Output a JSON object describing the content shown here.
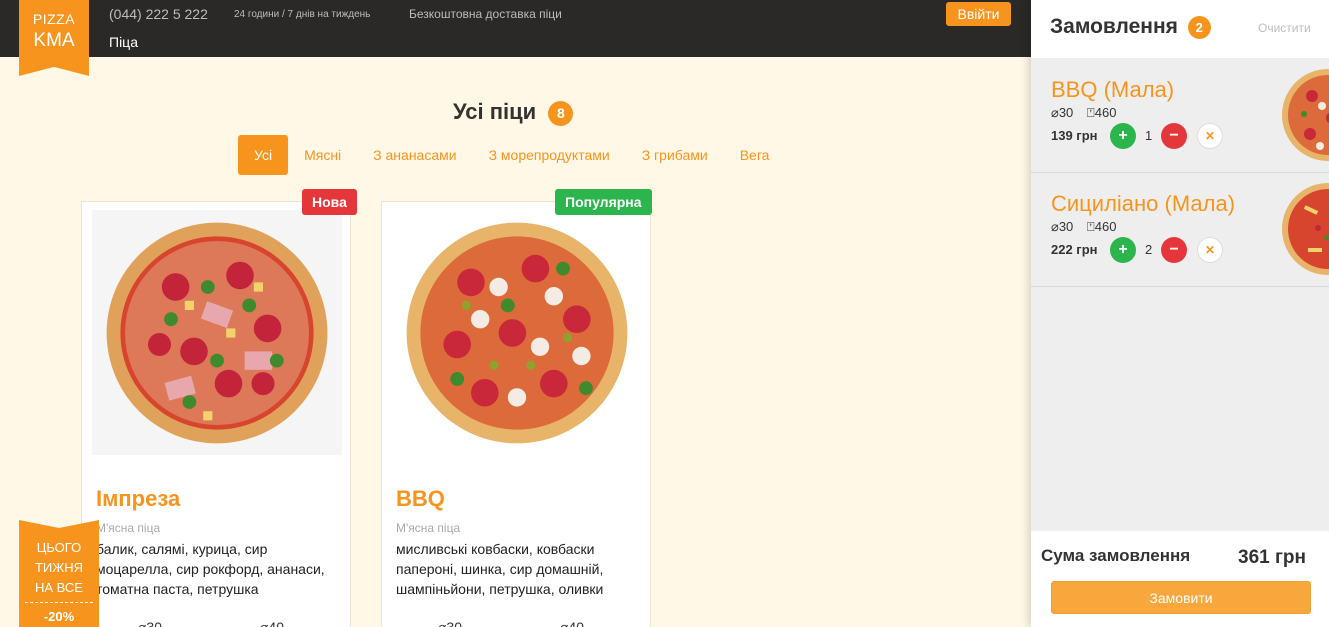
{
  "logo": {
    "line1": "PIZZA",
    "line2": "KMA"
  },
  "header": {
    "phone": "(044) 222 5 222",
    "hours": "24 години / 7 днів на тиждень",
    "delivery": "Безкоштовна доставка піци",
    "login_label": "Ввійти",
    "nav_pizza": "Піца"
  },
  "main": {
    "title": "Усі піци",
    "count": "8",
    "tabs": [
      {
        "label": "Усі",
        "active": true
      },
      {
        "label": "Мясні"
      },
      {
        "label": "З ананасами"
      },
      {
        "label": "З морепродуктами"
      },
      {
        "label": "З грибами"
      },
      {
        "label": "Вега"
      }
    ]
  },
  "cards": [
    {
      "badge": "Нова",
      "name": "Імпреза",
      "type": "М'ясна піца",
      "description": "балик, салямі, курица, сир моцарелла, сир рокфорд, ананаси, томатна паста, петрушка",
      "size_a": "⌀30",
      "size_b": "⌀40"
    },
    {
      "badge": "Популярна",
      "name": "BBQ",
      "type": "М'ясна піца",
      "description": "мисливські ковбаски, ковбаски папероні, шинка, сир домашній, шампіньйони, петрушка, оливки",
      "size_a": "⌀30",
      "size_b": "⌀40"
    }
  ],
  "promo": {
    "text1": "ЦЬОГО",
    "text2": "ТИЖНЯ",
    "text3": "НА ВСЕ",
    "discount": "-20%"
  },
  "order": {
    "title": "Замовлення",
    "count": "2",
    "clear_label": "Очистити",
    "items": [
      {
        "name": "BBQ (Мала)",
        "diameter": "30",
        "weight": "460",
        "price": "139 грн",
        "qty": "1"
      },
      {
        "name": "Сициліано (Мала)",
        "diameter": "30",
        "weight": "460",
        "price": "222 грн",
        "qty": "2"
      }
    ],
    "sum_label": "Сума замовлення",
    "sum_value": "361 грн",
    "submit_label": "Замовити"
  },
  "colors": {
    "accent": "#f7941d",
    "new_badge": "#e5373b",
    "popular_badge": "#2cb44d",
    "header_bg": "#2a2927",
    "page_bg": "#fff8e6"
  }
}
